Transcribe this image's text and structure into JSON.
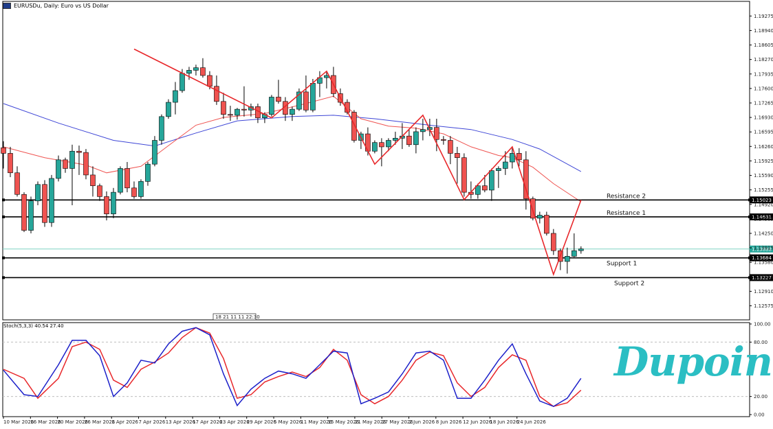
{
  "header": {
    "title": "EURUSDu, Daily: Euro vs US Dollar"
  },
  "colors": {
    "bull": "#26a69a",
    "bear": "#ef5350",
    "ma_fast": "#ef5350",
    "ma_slow": "#3d45d6",
    "zigzag": "#e8272a",
    "current_line": "#7fd3c4",
    "level_line": "#000000",
    "brand": "#2bbec3"
  },
  "brand": {
    "text": "Dupoin"
  },
  "chart_data": {
    "type": "candlestick",
    "symbol": "EURUSDu",
    "timeframe": "Daily",
    "price_axis": {
      "ylim": [
        1.1225,
        1.1955
      ],
      "ticks": [
        "1.19275",
        "1.18940",
        "1.18605",
        "1.18270",
        "1.17935",
        "1.17600",
        "1.17265",
        "1.16930",
        "1.16595",
        "1.16260",
        "1.15925",
        "1.15590",
        "1.15255",
        "1.14920",
        "1.14585",
        "1.14250",
        "1.13915",
        "1.13580",
        "1.13245",
        "1.12910",
        "1.12575"
      ]
    },
    "x_ticks": [
      "10 Mar 2026",
      "16 Mar 2026",
      "20 Mar 2026",
      "26 Mar 2026",
      "1 Apr 2026",
      "7 Apr 2026",
      "13 Apr 2026",
      "17 Apr 2026",
      "23 Apr 2026",
      "29 Apr 2026",
      "5 May 2026",
      "11 May 2026",
      "15 May 2026",
      "21 May 2026",
      "27 May 2026",
      "2 Jun 2026",
      "8 Jun 2026",
      "12 Jun 2026",
      "18 Jun 2026",
      "24 Jun 2026"
    ],
    "candles": [
      [
        1.1623,
        1.1638,
        1.1575,
        1.161
      ],
      [
        1.161,
        1.1625,
        1.1555,
        1.1565
      ],
      [
        1.1565,
        1.158,
        1.151,
        1.1515
      ],
      [
        1.1515,
        1.152,
        1.1428,
        1.1432
      ],
      [
        1.1432,
        1.151,
        1.1425,
        1.15
      ],
      [
        1.15,
        1.1545,
        1.149,
        1.1538
      ],
      [
        1.1538,
        1.1548,
        1.144,
        1.145
      ],
      [
        1.145,
        1.156,
        1.144,
        1.1552
      ],
      [
        1.1552,
        1.1605,
        1.1545,
        1.1595
      ],
      [
        1.1595,
        1.16,
        1.1565,
        1.1575
      ],
      [
        1.1575,
        1.163,
        1.149,
        1.1615
      ],
      [
        1.1615,
        1.1628,
        1.156,
        1.1612
      ],
      [
        1.1612,
        1.162,
        1.155,
        1.156
      ],
      [
        1.156,
        1.158,
        1.151,
        1.1535
      ],
      [
        1.1535,
        1.154,
        1.15,
        1.151
      ],
      [
        1.151,
        1.1522,
        1.1455,
        1.147
      ],
      [
        1.147,
        1.153,
        1.146,
        1.152
      ],
      [
        1.152,
        1.158,
        1.1515,
        1.1575
      ],
      [
        1.1575,
        1.159,
        1.152,
        1.153
      ],
      [
        1.153,
        1.1545,
        1.1505,
        1.151
      ],
      [
        1.151,
        1.155,
        1.1505,
        1.1545
      ],
      [
        1.1545,
        1.159,
        1.1535,
        1.1585
      ],
      [
        1.1585,
        1.165,
        1.158,
        1.164
      ],
      [
        1.164,
        1.17,
        1.163,
        1.1695
      ],
      [
        1.1695,
        1.1735,
        1.169,
        1.1728
      ],
      [
        1.1728,
        1.1775,
        1.17,
        1.1755
      ],
      [
        1.1755,
        1.1805,
        1.175,
        1.1795
      ],
      [
        1.1795,
        1.181,
        1.178,
        1.1802
      ],
      [
        1.1802,
        1.1815,
        1.179,
        1.1808
      ],
      [
        1.1808,
        1.183,
        1.1785,
        1.179
      ],
      [
        1.179,
        1.18,
        1.1758,
        1.1765
      ],
      [
        1.1765,
        1.179,
        1.1722,
        1.173
      ],
      [
        1.173,
        1.175,
        1.169,
        1.17
      ],
      [
        1.17,
        1.172,
        1.1685,
        1.1698
      ],
      [
        1.1698,
        1.1715,
        1.1688,
        1.1712
      ],
      [
        1.1712,
        1.1765,
        1.1695,
        1.171
      ],
      [
        1.171,
        1.1725,
        1.1695,
        1.1718
      ],
      [
        1.1718,
        1.1725,
        1.168,
        1.1692
      ],
      [
        1.1692,
        1.1705,
        1.168,
        1.17
      ],
      [
        1.17,
        1.1745,
        1.1695,
        1.174
      ],
      [
        1.174,
        1.178,
        1.1725,
        1.173
      ],
      [
        1.173,
        1.174,
        1.1685,
        1.17
      ],
      [
        1.17,
        1.1718,
        1.1685,
        1.1712
      ],
      [
        1.1712,
        1.176,
        1.1708,
        1.1752
      ],
      [
        1.1752,
        1.179,
        1.1705,
        1.171
      ],
      [
        1.171,
        1.1782,
        1.1705,
        1.1772
      ],
      [
        1.1772,
        1.18,
        1.174,
        1.1785
      ],
      [
        1.1785,
        1.18,
        1.176,
        1.179
      ],
      [
        1.179,
        1.181,
        1.174,
        1.1748
      ],
      [
        1.1748,
        1.176,
        1.172,
        1.1728
      ],
      [
        1.1728,
        1.1735,
        1.17,
        1.1705
      ],
      [
        1.1705,
        1.171,
        1.1635,
        1.164
      ],
      [
        1.164,
        1.166,
        1.162,
        1.1655
      ],
      [
        1.1655,
        1.167,
        1.1605,
        1.1615
      ],
      [
        1.1615,
        1.164,
        1.161,
        1.1635
      ],
      [
        1.1635,
        1.1645,
        1.158,
        1.1625
      ],
      [
        1.1625,
        1.1645,
        1.1615,
        1.164
      ],
      [
        1.164,
        1.166,
        1.163,
        1.1645
      ],
      [
        1.1645,
        1.168,
        1.162,
        1.165
      ],
      [
        1.165,
        1.1665,
        1.1625,
        1.163
      ],
      [
        1.163,
        1.167,
        1.161,
        1.166
      ],
      [
        1.166,
        1.169,
        1.164,
        1.1665
      ],
      [
        1.1665,
        1.169,
        1.165,
        1.167
      ],
      [
        1.167,
        1.169,
        1.1615,
        1.1642
      ],
      [
        1.1642,
        1.165,
        1.163,
        1.164
      ],
      [
        1.164,
        1.165,
        1.1585,
        1.161
      ],
      [
        1.161,
        1.1625,
        1.154,
        1.16
      ],
      [
        1.16,
        1.161,
        1.151,
        1.152
      ],
      [
        1.152,
        1.1545,
        1.1505,
        1.1515
      ],
      [
        1.1515,
        1.154,
        1.1505,
        1.1535
      ],
      [
        1.1535,
        1.156,
        1.152,
        1.1525
      ],
      [
        1.1525,
        1.1575,
        1.15,
        1.157
      ],
      [
        1.157,
        1.158,
        1.153,
        1.1575
      ],
      [
        1.1575,
        1.1615,
        1.156,
        1.159
      ],
      [
        1.159,
        1.1622,
        1.1575,
        1.161
      ],
      [
        1.161,
        1.1622,
        1.158,
        1.1595
      ],
      [
        1.1595,
        1.1615,
        1.148,
        1.1505
      ],
      [
        1.1505,
        1.151,
        1.1455,
        1.146
      ],
      [
        1.146,
        1.1475,
        1.1448,
        1.1467
      ],
      [
        1.1467,
        1.1475,
        1.142,
        1.1425
      ],
      [
        1.1425,
        1.1435,
        1.1375,
        1.1385
      ],
      [
        1.1385,
        1.139,
        1.134,
        1.136
      ],
      [
        1.136,
        1.1392,
        1.1332,
        1.1372
      ],
      [
        1.1372,
        1.1425,
        1.137,
        1.1385
      ],
      [
        1.1385,
        1.1395,
        1.1378,
        1.1389
      ]
    ],
    "levels": [
      {
        "name": "Resistance 2",
        "price": 1.15023,
        "price_label": "1.15023"
      },
      {
        "name": "Resistance 1",
        "price": 1.14631,
        "price_label": "1.14631"
      },
      {
        "name": "Support 1",
        "price": 1.13684,
        "price_label": "1.13684"
      },
      {
        "name": "Support 2",
        "price": 1.13227,
        "price_label": "1.13227"
      }
    ],
    "current_price": {
      "price": 1.13888,
      "label": "1.13888"
    },
    "vline_label": "18 21 11 11 22:30",
    "zigzag": [
      [
        19,
        1.1851
      ],
      [
        39,
        1.1692
      ],
      [
        47,
        1.18
      ],
      [
        54,
        1.1585
      ],
      [
        61,
        1.1698
      ],
      [
        67,
        1.1503
      ],
      [
        74,
        1.1625
      ],
      [
        80,
        1.133
      ],
      [
        84,
        1.1502
      ]
    ],
    "ma_fast": [
      [
        0,
        1.1625
      ],
      [
        6,
        1.16
      ],
      [
        12,
        1.1583
      ],
      [
        15,
        1.1565
      ],
      [
        20,
        1.158
      ],
      [
        24,
        1.1628
      ],
      [
        28,
        1.1675
      ],
      [
        32,
        1.1693
      ],
      [
        38,
        1.1702
      ],
      [
        44,
        1.1725
      ],
      [
        48,
        1.1742
      ],
      [
        52,
        1.169
      ],
      [
        56,
        1.1673
      ],
      [
        60,
        1.1668
      ],
      [
        64,
        1.1655
      ],
      [
        68,
        1.1625
      ],
      [
        72,
        1.1605
      ],
      [
        74,
        1.16
      ],
      [
        77,
        1.1578
      ],
      [
        80,
        1.154
      ],
      [
        84,
        1.1498
      ]
    ],
    "ma_slow": [
      [
        0,
        1.1725
      ],
      [
        8,
        1.168
      ],
      [
        16,
        1.164
      ],
      [
        22,
        1.1627
      ],
      [
        28,
        1.1657
      ],
      [
        34,
        1.1685
      ],
      [
        42,
        1.1695
      ],
      [
        48,
        1.1698
      ],
      [
        54,
        1.169
      ],
      [
        62,
        1.1675
      ],
      [
        68,
        1.1665
      ],
      [
        74,
        1.1642
      ],
      [
        78,
        1.162
      ],
      [
        84,
        1.1568
      ]
    ],
    "stochastic": {
      "label": "Stoch(5,3,3) 40.54 27.40",
      "k_value": 40.54,
      "d_value": 27.4,
      "ylim": [
        0,
        100
      ],
      "ticks": [
        "100.00",
        "80.00",
        "20.00",
        "0.00"
      ],
      "levels": [
        80,
        20
      ],
      "k": [
        [
          0,
          49
        ],
        [
          3,
          22
        ],
        [
          5,
          20
        ],
        [
          8,
          55
        ],
        [
          10,
          82
        ],
        [
          12,
          82
        ],
        [
          14,
          65
        ],
        [
          16,
          20
        ],
        [
          18,
          35
        ],
        [
          20,
          60
        ],
        [
          22,
          57
        ],
        [
          24,
          78
        ],
        [
          26,
          92
        ],
        [
          28,
          96
        ],
        [
          30,
          88
        ],
        [
          32,
          45
        ],
        [
          34,
          10
        ],
        [
          36,
          28
        ],
        [
          38,
          40
        ],
        [
          40,
          48
        ],
        [
          42,
          45
        ],
        [
          44,
          40
        ],
        [
          46,
          55
        ],
        [
          48,
          70
        ],
        [
          50,
          68
        ],
        [
          52,
          12
        ],
        [
          54,
          18
        ],
        [
          56,
          25
        ],
        [
          58,
          45
        ],
        [
          60,
          68
        ],
        [
          62,
          70
        ],
        [
          64,
          60
        ],
        [
          66,
          18
        ],
        [
          68,
          18
        ],
        [
          70,
          38
        ],
        [
          72,
          60
        ],
        [
          74,
          78
        ],
        [
          76,
          45
        ],
        [
          78,
          15
        ],
        [
          80,
          9
        ],
        [
          82,
          18
        ],
        [
          84,
          40
        ]
      ],
      "d": [
        [
          0,
          50
        ],
        [
          3,
          40
        ],
        [
          5,
          18
        ],
        [
          8,
          40
        ],
        [
          10,
          75
        ],
        [
          12,
          80
        ],
        [
          14,
          72
        ],
        [
          16,
          38
        ],
        [
          18,
          30
        ],
        [
          20,
          50
        ],
        [
          22,
          58
        ],
        [
          24,
          68
        ],
        [
          26,
          85
        ],
        [
          28,
          96
        ],
        [
          30,
          90
        ],
        [
          32,
          62
        ],
        [
          34,
          18
        ],
        [
          36,
          22
        ],
        [
          38,
          36
        ],
        [
          40,
          42
        ],
        [
          42,
          47
        ],
        [
          44,
          42
        ],
        [
          46,
          52
        ],
        [
          48,
          72
        ],
        [
          50,
          60
        ],
        [
          52,
          22
        ],
        [
          54,
          12
        ],
        [
          56,
          20
        ],
        [
          58,
          38
        ],
        [
          60,
          60
        ],
        [
          62,
          69
        ],
        [
          64,
          65
        ],
        [
          66,
          35
        ],
        [
          68,
          20
        ],
        [
          70,
          30
        ],
        [
          72,
          52
        ],
        [
          74,
          66
        ],
        [
          76,
          60
        ],
        [
          78,
          20
        ],
        [
          80,
          9
        ],
        [
          82,
          13
        ],
        [
          84,
          27
        ]
      ]
    }
  }
}
